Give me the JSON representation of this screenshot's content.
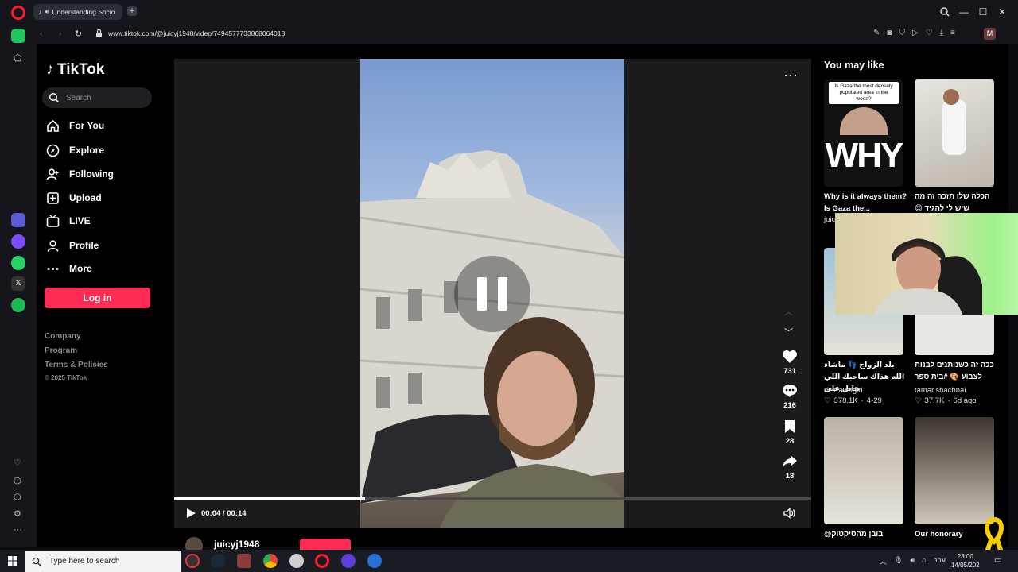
{
  "browser": {
    "tab_title": "Understanding Socio",
    "url": "www.tiktok.com/@juicyj1948/video/7494577733868064018",
    "profile_initial": "M"
  },
  "sidebar": {
    "logo_text": "TikTok",
    "search_placeholder": "Search",
    "nav": [
      {
        "label": "For You",
        "icon": "home-icon"
      },
      {
        "label": "Explore",
        "icon": "compass-icon"
      },
      {
        "label": "Following",
        "icon": "user-plus-icon"
      },
      {
        "label": "Upload",
        "icon": "plus-square-icon"
      },
      {
        "label": "LIVE",
        "icon": "tv-icon"
      },
      {
        "label": "Profile",
        "icon": "person-icon"
      },
      {
        "label": "More",
        "icon": "dots-icon"
      }
    ],
    "login_label": "Log in",
    "footer": {
      "company": "Company",
      "program": "Program",
      "terms": "Terms & Policies",
      "copyright": "© 2025 TikTok"
    }
  },
  "video": {
    "likes": "731",
    "comments": "216",
    "saves": "28",
    "shares": "18",
    "time": "00:04 / 00:14",
    "progress": 0.3,
    "author": "juicyj1948"
  },
  "recommendations": {
    "title": "You may like",
    "items": [
      {
        "caption": "Why is it always them? Is Gaza the...",
        "author": "juic",
        "thumb_text": "Is Gaza the most densely populated area in the world?",
        "big_text": "WHY"
      },
      {
        "caption": "הכלה שלו תזכה זה מה שיש לי להגיד 😍",
        "author": ""
      },
      {
        "caption": "بلد الزواج 👣 ماشاء الله هذاك ساحبك اللي هايل على",
        "author": "dz.travelgirl",
        "likes": "378.1K",
        "date": "4-29"
      },
      {
        "caption": "ככה זה כשנותנים לבנות לצבוע 🎨 #בית ספר",
        "author": "tamar.shachnai",
        "likes": "37.7K",
        "date": "6d ago"
      },
      {
        "caption": "@בובן מהטיקטוק",
        "author": ""
      },
      {
        "caption": "Our honorary",
        "author": ""
      }
    ]
  },
  "taskbar": {
    "search_placeholder": "Type here to search",
    "lang": "עבר",
    "time": "23:00",
    "date": "14/05/202"
  }
}
